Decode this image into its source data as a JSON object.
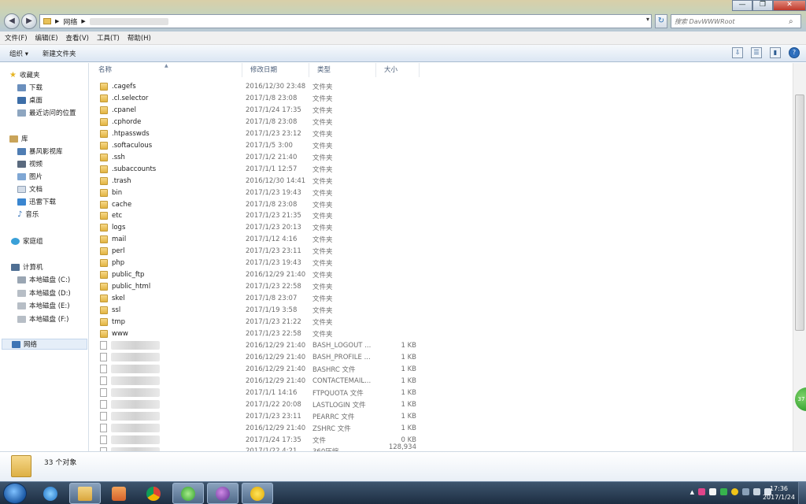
{
  "window": {
    "minimize_icon": "minimize-icon",
    "maximize_icon": "restore-icon",
    "close_icon": "close-icon"
  },
  "address": {
    "crumb": "网络",
    "search_placeholder": "搜索 DavWWWRoot"
  },
  "menu": [
    "文件(F)",
    "编辑(E)",
    "查看(V)",
    "工具(T)",
    "帮助(H)"
  ],
  "toolbar": {
    "organize": "组织 ▾",
    "new_folder": "新建文件夹"
  },
  "nav": {
    "favorites": "收藏夹",
    "downloads": "下载",
    "desktop": "桌面",
    "recent": "最近访问的位置",
    "libraries": "库",
    "storm": "暴风影视库",
    "videos": "视频",
    "pictures": "图片",
    "documents": "文档",
    "thunder": "迅雷下载",
    "music": "音乐",
    "homegroup": "家庭组",
    "computer": "计算机",
    "drive_c": "本地磁盘 (C:)",
    "drive_d": "本地磁盘 (D:)",
    "drive_e": "本地磁盘 (E:)",
    "drive_f": "本地磁盘 (F:)",
    "network": "网络"
  },
  "columns": {
    "name": "名称",
    "modified": "修改日期",
    "type": "类型",
    "size": "大小"
  },
  "files": [
    {
      "name": ".cagefs",
      "date": "2016/12/30 23:48",
      "type": "文件夹",
      "size": "",
      "kind": "folder"
    },
    {
      "name": ".cl.selector",
      "date": "2017/1/8 23:08",
      "type": "文件夹",
      "size": "",
      "kind": "folder"
    },
    {
      "name": ".cpanel",
      "date": "2017/1/24 17:35",
      "type": "文件夹",
      "size": "",
      "kind": "folder"
    },
    {
      "name": ".cphorde",
      "date": "2017/1/8 23:08",
      "type": "文件夹",
      "size": "",
      "kind": "folder"
    },
    {
      "name": ".htpasswds",
      "date": "2017/1/23 23:12",
      "type": "文件夹",
      "size": "",
      "kind": "folder"
    },
    {
      "name": ".softaculous",
      "date": "2017/1/5 3:00",
      "type": "文件夹",
      "size": "",
      "kind": "folder"
    },
    {
      "name": ".ssh",
      "date": "2017/1/2 21:40",
      "type": "文件夹",
      "size": "",
      "kind": "folder"
    },
    {
      "name": ".subaccounts",
      "date": "2017/1/1 12:57",
      "type": "文件夹",
      "size": "",
      "kind": "folder"
    },
    {
      "name": ".trash",
      "date": "2016/12/30 14:41",
      "type": "文件夹",
      "size": "",
      "kind": "folder"
    },
    {
      "name": "bin",
      "date": "2017/1/23 19:43",
      "type": "文件夹",
      "size": "",
      "kind": "folder"
    },
    {
      "name": "cache",
      "date": "2017/1/8 23:08",
      "type": "文件夹",
      "size": "",
      "kind": "folder"
    },
    {
      "name": "etc",
      "date": "2017/1/23 21:35",
      "type": "文件夹",
      "size": "",
      "kind": "folder"
    },
    {
      "name": "logs",
      "date": "2017/1/23 20:13",
      "type": "文件夹",
      "size": "",
      "kind": "folder"
    },
    {
      "name": "mail",
      "date": "2017/1/12 4:16",
      "type": "文件夹",
      "size": "",
      "kind": "folder"
    },
    {
      "name": "perl",
      "date": "2017/1/23 23:11",
      "type": "文件夹",
      "size": "",
      "kind": "folder"
    },
    {
      "name": "php",
      "date": "2017/1/23 19:43",
      "type": "文件夹",
      "size": "",
      "kind": "folder"
    },
    {
      "name": "public_ftp",
      "date": "2016/12/29 21:40",
      "type": "文件夹",
      "size": "",
      "kind": "folder"
    },
    {
      "name": "public_html",
      "date": "2017/1/23 22:58",
      "type": "文件夹",
      "size": "",
      "kind": "folder"
    },
    {
      "name": "skel",
      "date": "2017/1/8 23:07",
      "type": "文件夹",
      "size": "",
      "kind": "folder"
    },
    {
      "name": "ssl",
      "date": "2017/1/19 3:58",
      "type": "文件夹",
      "size": "",
      "kind": "folder"
    },
    {
      "name": "tmp",
      "date": "2017/1/23 21:22",
      "type": "文件夹",
      "size": "",
      "kind": "folder"
    },
    {
      "name": "www",
      "date": "2017/1/23 22:58",
      "type": "文件夹",
      "size": "",
      "kind": "folder"
    },
    {
      "name": "",
      "date": "2016/12/29 21:40",
      "type": "BASH_LOGOUT ...",
      "size": "1 KB",
      "kind": "file"
    },
    {
      "name": "",
      "date": "2016/12/29 21:40",
      "type": "BASH_PROFILE ...",
      "size": "1 KB",
      "kind": "file"
    },
    {
      "name": "",
      "date": "2016/12/29 21:40",
      "type": "BASHRC 文件",
      "size": "1 KB",
      "kind": "file"
    },
    {
      "name": "",
      "date": "2016/12/29 21:40",
      "type": "CONTACTEMAIL...",
      "size": "1 KB",
      "kind": "file"
    },
    {
      "name": "",
      "date": "2017/1/1 14:16",
      "type": "FTPQUOTA 文件",
      "size": "1 KB",
      "kind": "file"
    },
    {
      "name": "",
      "date": "2017/1/22 20:08",
      "type": "LASTLOGIN 文件",
      "size": "1 KB",
      "kind": "file"
    },
    {
      "name": "",
      "date": "2017/1/23 23:11",
      "type": "PEARRC 文件",
      "size": "1 KB",
      "kind": "file"
    },
    {
      "name": "",
      "date": "2016/12/29 21:40",
      "type": "ZSHRC 文件",
      "size": "1 KB",
      "kind": "file"
    },
    {
      "name": "",
      "date": "2017/1/24 17:35",
      "type": "文件",
      "size": "0 KB",
      "kind": "file"
    },
    {
      "name": "",
      "date": "2017/1/22 4:21",
      "type": "360压缩",
      "size": "128,934 KB",
      "kind": "file"
    }
  ],
  "details": {
    "count": "33 个对象"
  },
  "badge": "37",
  "clock": {
    "time": "17:36",
    "date": "2017/1/24"
  }
}
